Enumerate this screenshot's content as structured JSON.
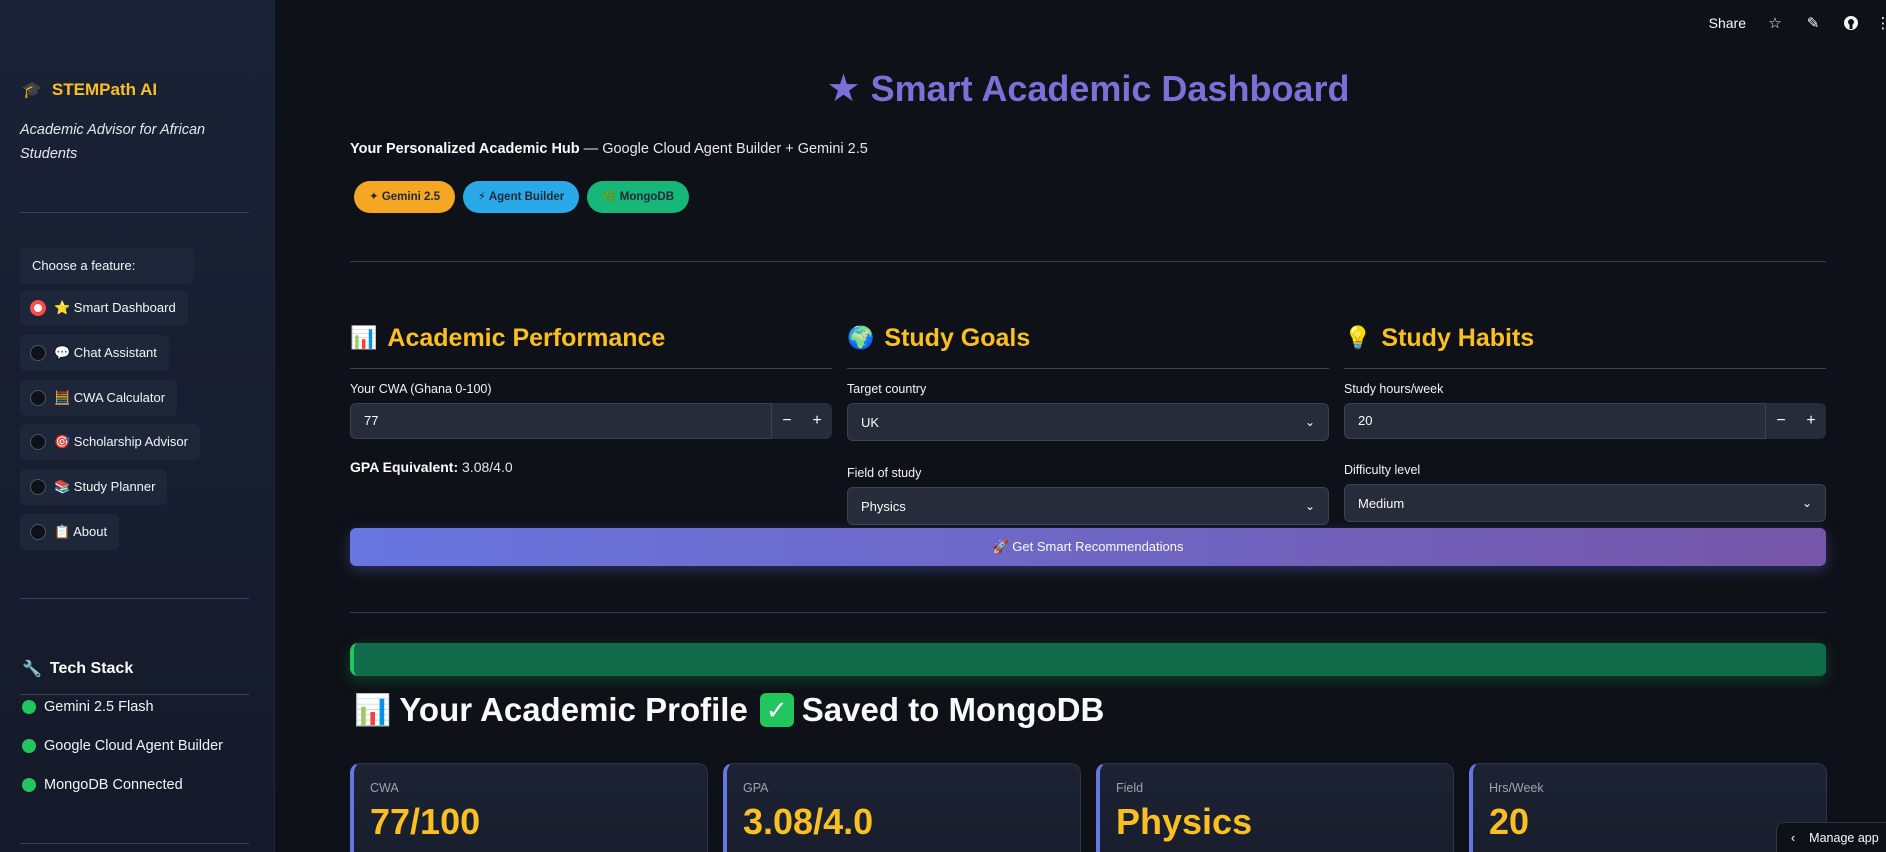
{
  "sidebar": {
    "brand": "STEMPath AI",
    "brand_icon": "graduation-cap-icon",
    "tagline": "Academic Advisor for African Students",
    "feature_prompt": "Choose a feature:",
    "items": [
      {
        "label": "⭐ Smart Dashboard",
        "selected": true
      },
      {
        "label": "💬 Chat Assistant",
        "selected": false
      },
      {
        "label": "🧮 CWA Calculator",
        "selected": false
      },
      {
        "label": "🎯 Scholarship Advisor",
        "selected": false
      },
      {
        "label": "📚 Study Planner",
        "selected": false
      },
      {
        "label": "📋 About",
        "selected": false
      }
    ],
    "tech_title": "Tech Stack",
    "tech_items": [
      "Gemini 2.5 Flash",
      "Google Cloud Agent Builder",
      "MongoDB Connected"
    ]
  },
  "topbar": {
    "share": "Share",
    "icons": [
      "star-icon",
      "pencil-icon",
      "github-icon",
      "more-icon"
    ]
  },
  "header": {
    "title": "Smart Academic Dashboard",
    "subtitle_bold": "Your Personalized Academic Hub",
    "subtitle_rest": " — Google Cloud Agent Builder + Gemini 2.5"
  },
  "pills": [
    "✦ Gemini 2.5",
    "⚡ Agent Builder",
    "🌿 MongoDB"
  ],
  "columns": {
    "performance": {
      "title": "Academic Performance",
      "cwa_label": "Your CWA (Ghana 0-100)",
      "cwa_value": "77",
      "gpa_label": "GPA Equivalent:",
      "gpa_value": " 3.08/4.0"
    },
    "goals": {
      "title": "Study Goals",
      "country_label": "Target country",
      "country_value": "UK",
      "field_label": "Field of study",
      "field_value": "Physics"
    },
    "habits": {
      "title": "Study Habits",
      "hours_label": "Study hours/week",
      "hours_value": "20",
      "difficulty_label": "Difficulty level",
      "difficulty_value": "Medium"
    }
  },
  "cta": "🚀 Get Smart Recommendations",
  "progress": {
    "fraction": 1.0
  },
  "profile": {
    "title": "Your Academic Profile",
    "saved": "Saved to MongoDB",
    "cards": [
      {
        "label": "CWA",
        "value": "77/100"
      },
      {
        "label": "GPA",
        "value": "3.08/4.0"
      },
      {
        "label": "Field",
        "value": "Physics"
      },
      {
        "label": "Hrs/Week",
        "value": "20"
      }
    ]
  },
  "manage_app": "Manage app",
  "colors": {
    "accent": "#7c6fd6",
    "gold": "#fbbf24",
    "radio": "#ff4b4b",
    "green": "#22c55e"
  }
}
